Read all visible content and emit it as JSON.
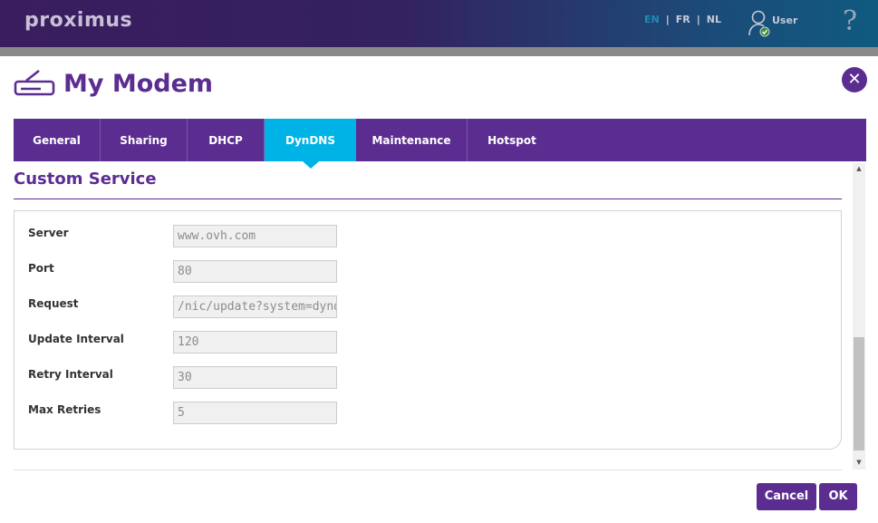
{
  "header": {
    "brand": "proximus",
    "languages": [
      "EN",
      "FR",
      "NL"
    ],
    "active_language": "EN",
    "user_label": "User",
    "help_icon": "?"
  },
  "page": {
    "title": "My Modem",
    "close_label": "✕"
  },
  "tabs": [
    {
      "label": "General",
      "active": false
    },
    {
      "label": "Sharing",
      "active": false
    },
    {
      "label": "DHCP",
      "active": false
    },
    {
      "label": "DynDNS",
      "active": true
    },
    {
      "label": "Maintenance",
      "active": false
    },
    {
      "label": "Hotspot",
      "active": false
    }
  ],
  "section": {
    "title": "Custom Service",
    "fields": [
      {
        "label": "Server",
        "value": "www.ovh.com"
      },
      {
        "label": "Port",
        "value": "80"
      },
      {
        "label": "Request",
        "value": "/nic/update?system=dyndns"
      },
      {
        "label": "Update Interval",
        "value": "120"
      },
      {
        "label": "Retry Interval",
        "value": "30"
      },
      {
        "label": "Max Retries",
        "value": "5"
      }
    ]
  },
  "footer": {
    "cancel_label": "Cancel",
    "ok_label": "OK"
  },
  "colors": {
    "brand_purple": "#5c2d91",
    "active_tab": "#00b3e6",
    "active_language": "#1c8fb5"
  },
  "icons": {
    "modem": "modem-icon",
    "user": "user-check-icon",
    "help": "help-icon",
    "close": "close-icon"
  }
}
